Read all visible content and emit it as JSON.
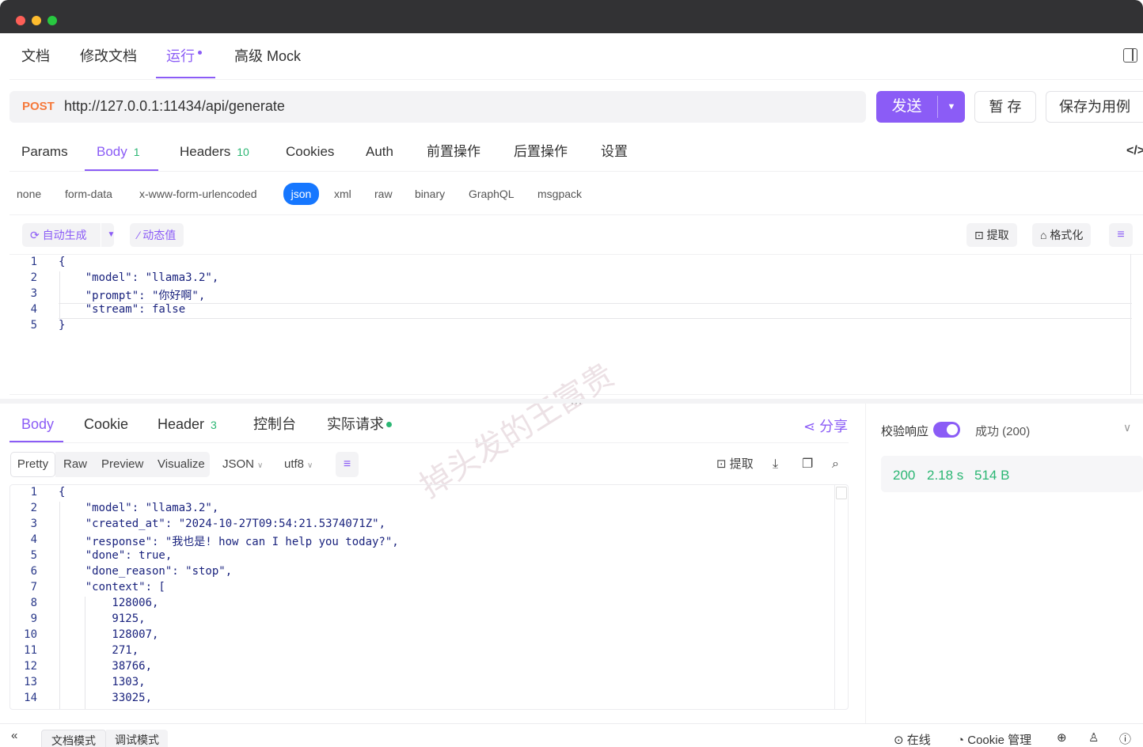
{
  "top_tabs": [
    {
      "label": "文档"
    },
    {
      "label": "修改文档"
    },
    {
      "label": "运行"
    },
    {
      "label": "高级 Mock"
    }
  ],
  "request": {
    "method": "POST",
    "url": "http://127.0.0.1:11434/api/generate",
    "send_label": "发送",
    "save_label": "暂 存",
    "save_example_label": "保存为用例"
  },
  "request_tabs": [
    {
      "label": "Params"
    },
    {
      "label": "Body",
      "badge": "1"
    },
    {
      "label": "Headers",
      "badge": "10"
    },
    {
      "label": "Cookies"
    },
    {
      "label": "Auth"
    },
    {
      "label": "前置操作"
    },
    {
      "label": "后置操作"
    },
    {
      "label": "设置"
    }
  ],
  "body_types": [
    "none",
    "form-data",
    "x-www-form-urlencoded",
    "json",
    "xml",
    "raw",
    "binary",
    "GraphQL",
    "msgpack"
  ],
  "editor_toolbar": {
    "auto_gen": "自动生成",
    "dynamic": "动态值",
    "extract": "提取",
    "format": "格式化"
  },
  "request_body_lines": [
    {
      "n": "1",
      "text": "{"
    },
    {
      "n": "2",
      "text": "    \"model\": \"llama3.2\","
    },
    {
      "n": "3",
      "text": "    \"prompt\": \"你好啊\","
    },
    {
      "n": "4",
      "text": "    \"stream\": false"
    },
    {
      "n": "5",
      "text": "}"
    }
  ],
  "watermark": "掉头发的王富贵",
  "response_tabs": [
    {
      "label": "Body"
    },
    {
      "label": "Cookie"
    },
    {
      "label": "Header",
      "badge": "3"
    },
    {
      "label": "控制台"
    },
    {
      "label": "实际请求"
    }
  ],
  "share_label": "分享",
  "view_tabs": {
    "pretty": "Pretty",
    "raw": "Raw",
    "preview": "Preview",
    "visualize": "Visualize",
    "format": "JSON",
    "encoding": "utf8",
    "extract": "提取"
  },
  "response_lines": [
    {
      "n": "1",
      "text": "{"
    },
    {
      "n": "2",
      "text": "    \"model\": \"llama3.2\","
    },
    {
      "n": "3",
      "text": "    \"created_at\": \"2024-10-27T09:54:21.5374071Z\","
    },
    {
      "n": "4",
      "text": "    \"response\": \"我也是! how can I help you today?\","
    },
    {
      "n": "5",
      "text": "    \"done\": true,"
    },
    {
      "n": "6",
      "text": "    \"done_reason\": \"stop\","
    },
    {
      "n": "7",
      "text": "    \"context\": ["
    },
    {
      "n": "8",
      "text": "        128006,"
    },
    {
      "n": "9",
      "text": "        9125,"
    },
    {
      "n": "10",
      "text": "        128007,"
    },
    {
      "n": "11",
      "text": "        271,"
    },
    {
      "n": "12",
      "text": "        38766,"
    },
    {
      "n": "13",
      "text": "        1303,"
    },
    {
      "n": "14",
      "text": "        33025,"
    }
  ],
  "validation": {
    "label": "校验响应",
    "result": "成功 (200)",
    "status": "200",
    "time": "2.18 s",
    "size": "514 B"
  },
  "bottom_bar": {
    "doc_mode": "文档模式",
    "debug_mode": "调试模式",
    "online": "在线",
    "cookie_mgmt": "Cookie 管理"
  },
  "colors": {
    "accent": "#8b5cf6",
    "json_chip": "#1677ff",
    "success": "#2bb673",
    "method_post": "#f5793b"
  }
}
